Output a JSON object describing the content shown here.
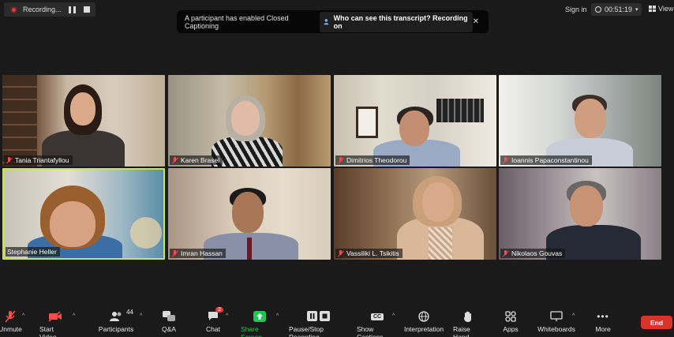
{
  "recording": {
    "label": "Recording..."
  },
  "banner": {
    "text": "A participant has enabled Closed Captioning",
    "link": "Who can see this transcript? Recording on"
  },
  "header": {
    "signin": "Sign in",
    "timer": "00:51:19",
    "view": "View"
  },
  "participants": [
    {
      "name": "Tania Triantafyllou",
      "muted": true,
      "active": false
    },
    {
      "name": "Karen Brasel",
      "muted": true,
      "active": false
    },
    {
      "name": "Dimitrios Theodorou",
      "muted": true,
      "active": false
    },
    {
      "name": "Ioannis Papaconstantinou",
      "muted": true,
      "active": false
    },
    {
      "name": "Stephanie Heller",
      "muted": false,
      "active": true
    },
    {
      "name": "Imran Hassan",
      "muted": true,
      "active": false
    },
    {
      "name": "Vassiliki L. Tsikitis",
      "muted": true,
      "active": false
    },
    {
      "name": "Nikolaos Gouvas",
      "muted": true,
      "active": false
    }
  ],
  "toolbar": {
    "unmute": "Unmute",
    "video": "Start Video",
    "participants": "Participants",
    "participants_count": "44",
    "qa": "Q&A",
    "chat": "Chat",
    "chat_badge": "2",
    "share": "Share Screen",
    "recording": "Pause/Stop Recording",
    "captions": "Show Captions",
    "captions_icon": "CC",
    "interpretation": "Interpretation",
    "raise_hand": "Raise Hand",
    "apps": "Apps",
    "whiteboards": "Whiteboards",
    "more": "More",
    "end": "End"
  },
  "colors": {
    "active_border": "#c9e83f",
    "end": "#d9342b",
    "share": "#23c552",
    "muted_icon": "#ff4d4d"
  }
}
